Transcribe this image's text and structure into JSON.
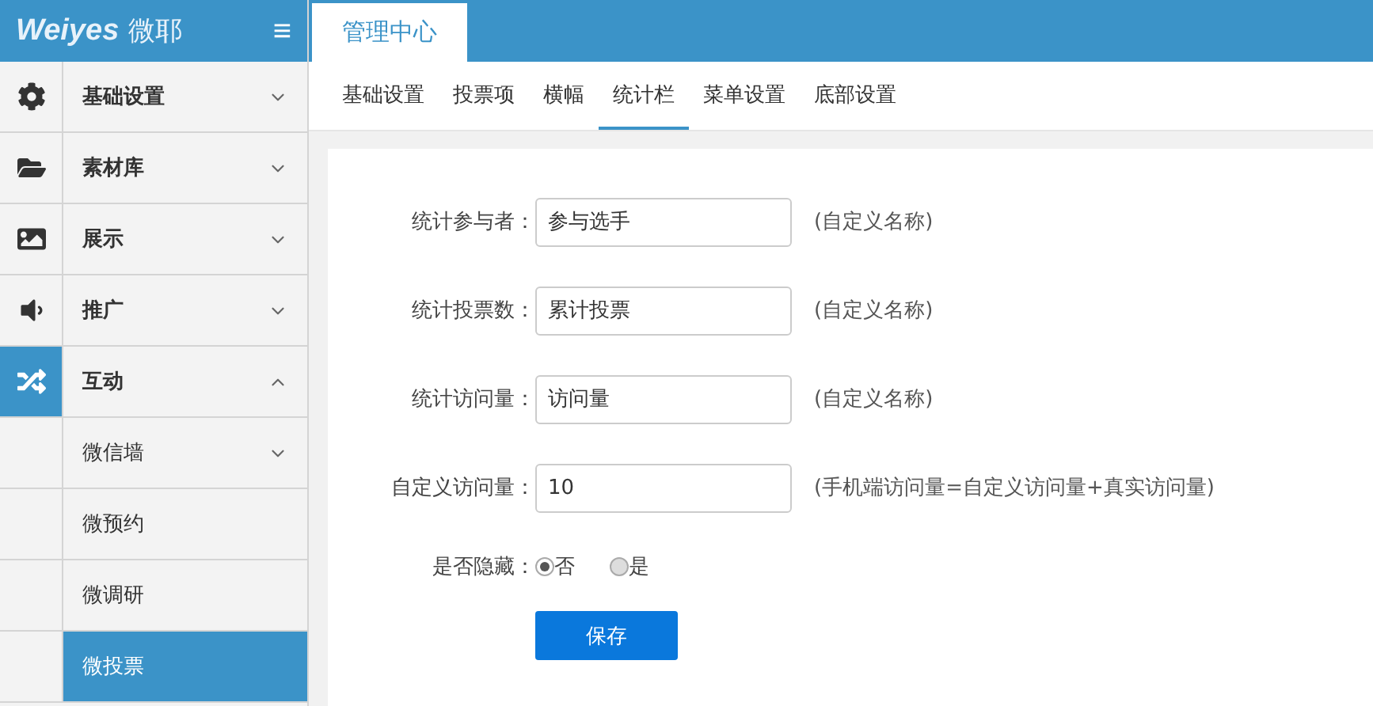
{
  "logo": {
    "wordmark": "Weiyes",
    "name": "微耶"
  },
  "menu_toggle": "≡",
  "header_tab": {
    "label": "管理中心",
    "selected": true
  },
  "sidebar": {
    "items": [
      {
        "label": "基础设置",
        "expanded": false,
        "selected": false
      },
      {
        "label": "素材库",
        "expanded": false,
        "selected": false
      },
      {
        "label": "展示",
        "expanded": false,
        "selected": false
      },
      {
        "label": "推广",
        "expanded": false,
        "selected": false
      },
      {
        "label": "互动",
        "expanded": true,
        "selected": true,
        "children": [
          {
            "label": "微信墙",
            "kind": "group",
            "selected": false
          },
          {
            "label": "微预约",
            "kind": "link",
            "selected": false
          },
          {
            "label": "微调研",
            "kind": "link",
            "selected": false
          },
          {
            "label": "微投票",
            "kind": "link",
            "selected": true
          }
        ]
      }
    ]
  },
  "tabs": [
    {
      "label": "基础设置",
      "selected": false
    },
    {
      "label": "投票项",
      "selected": false
    },
    {
      "label": "横幅",
      "selected": false
    },
    {
      "label": "统计栏",
      "selected": true
    },
    {
      "label": "菜单设置",
      "selected": false
    },
    {
      "label": "底部设置",
      "selected": false
    }
  ],
  "form": {
    "fields": [
      {
        "label": "统计参与者：",
        "value": "参与选手",
        "hint": "(自定义名称)"
      },
      {
        "label": "统计投票数：",
        "value": "累计投票",
        "hint": "(自定义名称)"
      },
      {
        "label": "统计访问量：",
        "value": "访问量",
        "hint": "(自定义名称)"
      },
      {
        "label": "自定义访问量：",
        "value": "10",
        "hint": "(手机端访问量=自定义访问量+真实访问量)"
      }
    ],
    "hide": {
      "label": "是否隐藏：",
      "options": [
        {
          "label": "否",
          "selected": true
        },
        {
          "label": "是",
          "selected": false
        }
      ]
    },
    "save_button": "保存"
  }
}
